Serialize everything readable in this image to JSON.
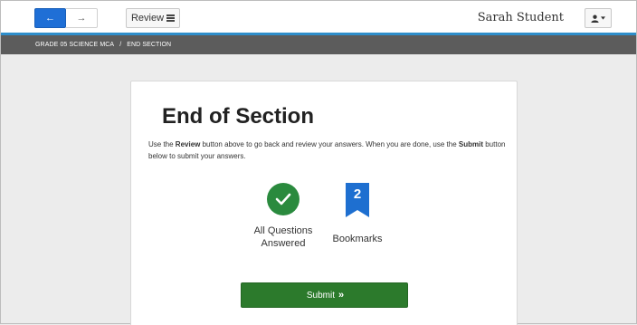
{
  "toolbar": {
    "back_icon": "arrow-left-icon",
    "forward_icon": "arrow-right-icon",
    "review_label": "Review",
    "review_icon": "list-icon",
    "user_name": "Sarah Student",
    "user_icon": "user-icon",
    "accent_color": "#2e8ecb"
  },
  "breadcrumb": {
    "test": "GRADE 05 SCIENCE MCA",
    "separator": "/",
    "section": "END SECTION"
  },
  "card": {
    "title": "End of Section",
    "instructions": {
      "p1": "Use the ",
      "review_word": "Review",
      "p2": " button above to go back and review your answers. When you are done, use the ",
      "submit_word": "Submit",
      "p3": " button below to submit your answers."
    },
    "answered": {
      "icon": "check-icon",
      "label": "All Questions Answered",
      "color": "#2a8a3e"
    },
    "bookmarks": {
      "icon": "bookmark-icon",
      "count": "2",
      "label": "Bookmarks",
      "color": "#1e6fd0"
    },
    "submit": {
      "label": "Submit",
      "icon": "double-chevron-right-icon",
      "glyph": "»",
      "color": "#2c7a2c"
    }
  }
}
